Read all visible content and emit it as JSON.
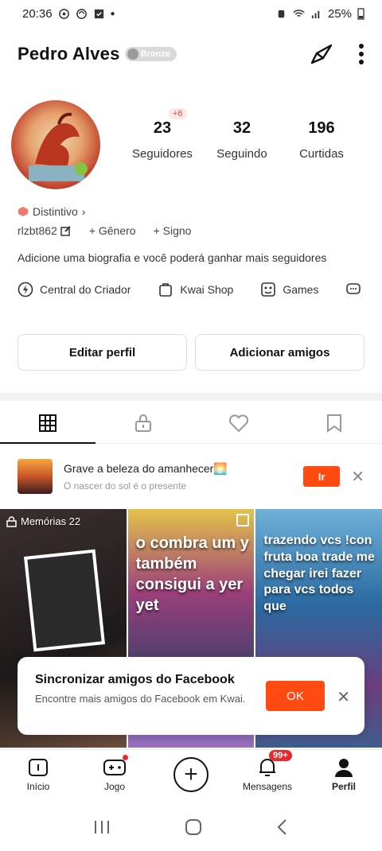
{
  "status_bar": {
    "time": "20:36",
    "battery": "25%"
  },
  "header": {
    "username": "Pedro Alves",
    "level_badge": "Bronze"
  },
  "stats": [
    {
      "value": "23",
      "label": "Seguidores",
      "delta": "+6"
    },
    {
      "value": "32",
      "label": "Seguindo"
    },
    {
      "value": "196",
      "label": "Curtidas"
    }
  ],
  "profile": {
    "distintivo": "Distintivo",
    "user_id": "rlzbt862",
    "gender": "+ Gênero",
    "sign": "+ Signo",
    "bio": "Adicione uma biografia e você poderá ganhar mais seguidores"
  },
  "shortcuts": [
    "Central do Criador",
    "Kwai Shop",
    "Games"
  ],
  "actions": {
    "edit": "Editar perfil",
    "add_friends": "Adicionar amigos"
  },
  "tabs": [
    "works-grid-icon",
    "lock-icon",
    "heart-icon",
    "bookmark-icon"
  ],
  "promo": {
    "title": "Grave a beleza do amanhecer🌅",
    "subtitle": "O nascer do sol é o presente",
    "button": "Ir"
  },
  "grid": [
    {
      "label": "Memórias 22",
      "text": ""
    },
    {
      "label": "",
      "text": "o combra um y também consigui a yer yet"
    },
    {
      "label": "",
      "text": "trazendo vcs !con fruta boa trade me chegar irei fazer para vcs todos que"
    }
  ],
  "toast": {
    "title": "Sincronizar amigos do Facebook",
    "subtitle": "Encontre mais amigos do Facebook em Kwai.",
    "ok": "OK"
  },
  "bottom_nav": [
    {
      "label": "Início"
    },
    {
      "label": "Jogo"
    },
    {
      "label": ""
    },
    {
      "label": "Mensagens",
      "badge": "99+"
    },
    {
      "label": "Perfil"
    }
  ],
  "colors": {
    "accent": "#ff4a12",
    "badge_red": "#e82a2a"
  }
}
